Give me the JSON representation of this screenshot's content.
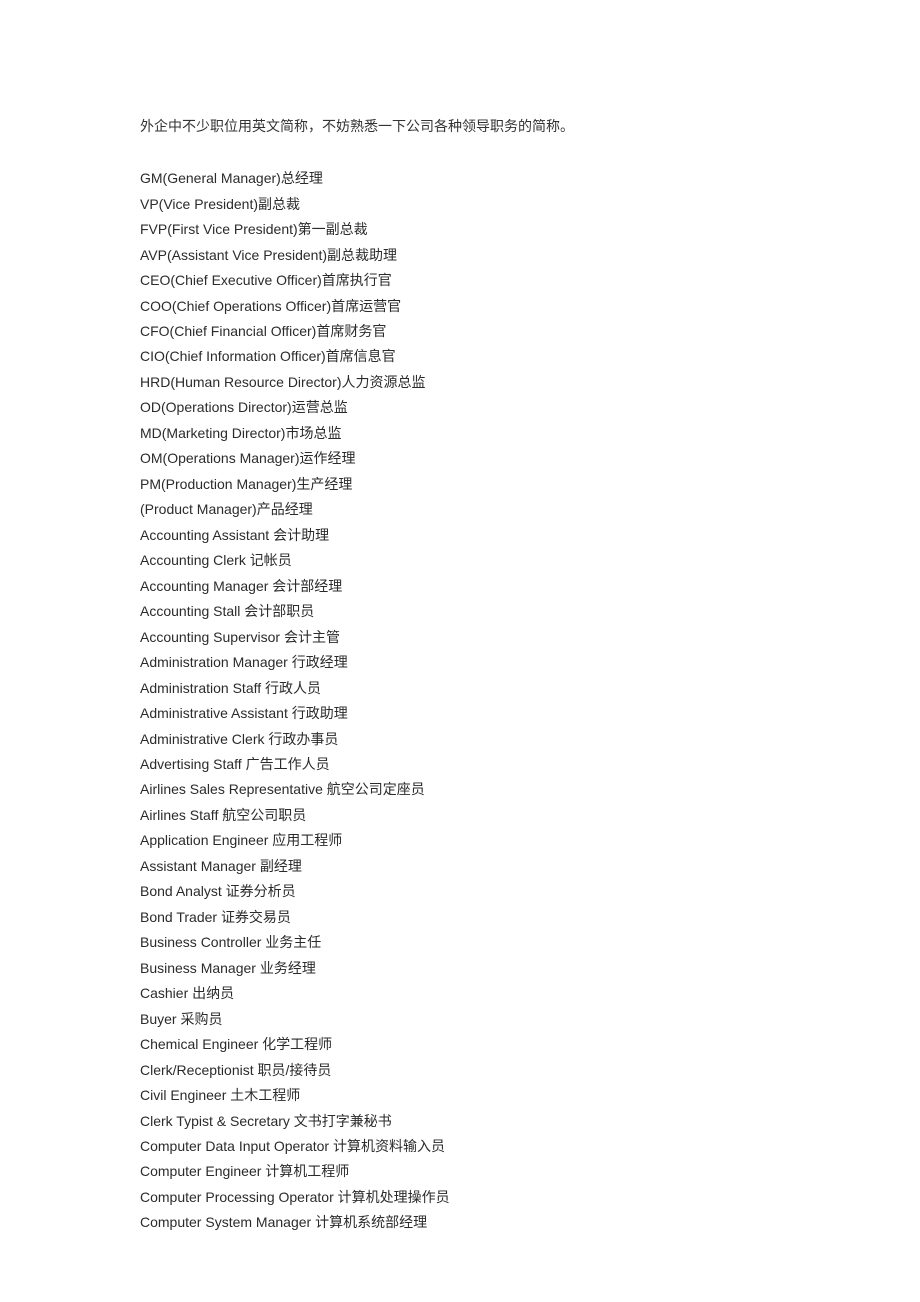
{
  "intro": "外企中不少职位用英文简称，不妨熟悉一下公司各种领导职务的简称。",
  "items": [
    "GM(General Manager)总经理",
    "VP(Vice President)副总裁",
    "FVP(First Vice President)第一副总裁",
    "AVP(Assistant Vice President)副总裁助理",
    "CEO(Chief Executive Officer)首席执行官",
    "COO(Chief Operations Officer)首席运营官",
    "CFO(Chief Financial Officer)首席财务官",
    "CIO(Chief Information Officer)首席信息官",
    "HRD(Human Resource Director)人力资源总监",
    "OD(Operations Director)运营总监",
    "MD(Marketing Director)市场总监",
    "OM(Operations Manager)运作经理",
    "PM(Production Manager)生产经理",
    "(Product Manager)产品经理",
    "Accounting Assistant  会计助理",
    "Accounting Clerk  记帐员",
    "Accounting Manager 会计部经理",
    "Accounting Stall 会计部职员",
    "Accounting Supervisor 会计主管",
    "Administration Manager 行政经理",
    "Administration Staff 行政人员",
    "Administrative Assistant 行政助理",
    "Administrative Clerk 行政办事员",
    "Advertising Staff 广告工作人员",
    "Airlines Sales Representative 航空公司定座员",
    "Airlines Staff 航空公司职员",
    "Application Engineer 应用工程师",
    "Assistant Manager 副经理",
    "Bond Analyst  证券分析员",
    "Bond Trader 证券交易员",
    "Business Controller 业务主任",
    "Business Manager 业务经理",
    "Cashier 出纳员",
    "Buyer 采购员",
    "Chemical Engineer 化学工程师",
    "Clerk/Receptionist 职员/接待员",
    "Civil Engineer 土木工程师",
    "Clerk Typist & Secretary 文书打字兼秘书",
    "Computer Data Input Operator 计算机资料输入员",
    "Computer Engineer 计算机工程师",
    "Computer Processing Operator 计算机处理操作员",
    "Computer System Manager 计算机系统部经理"
  ]
}
